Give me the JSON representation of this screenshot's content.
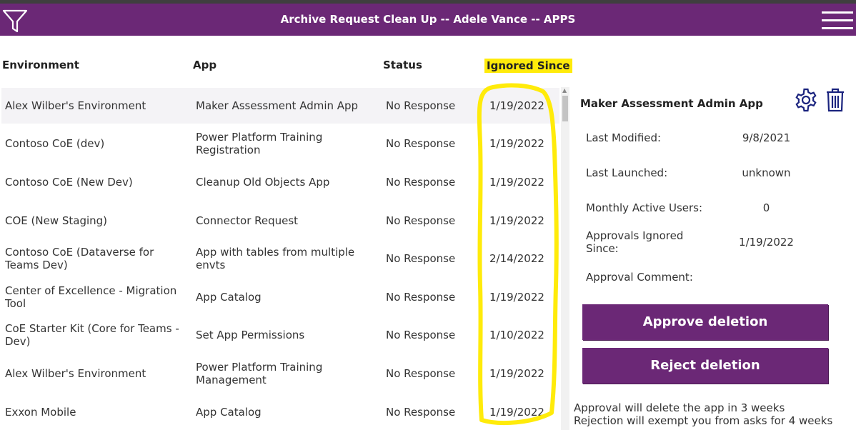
{
  "header": {
    "title": "Archive Request Clean Up -- Adele Vance -- APPS"
  },
  "columns": {
    "environment": "Environment",
    "app": "App",
    "status": "Status",
    "ignored_since": "Ignored Since"
  },
  "rows": [
    {
      "environment": "Alex Wilber's Environment",
      "app": "Maker Assessment Admin App",
      "status": "No Response",
      "ignored_since": "1/19/2022"
    },
    {
      "environment": "Contoso CoE (dev)",
      "app": "Power Platform Training Registration",
      "status": "No Response",
      "ignored_since": "1/19/2022"
    },
    {
      "environment": "Contoso CoE (New Dev)",
      "app": "Cleanup Old Objects App",
      "status": "No Response",
      "ignored_since": "1/19/2022"
    },
    {
      "environment": "COE (New Staging)",
      "app": "Connector Request",
      "status": "No Response",
      "ignored_since": "1/19/2022"
    },
    {
      "environment": "Contoso CoE (Dataverse for Teams Dev)",
      "app": "App with tables from multiple envts",
      "status": "No Response",
      "ignored_since": "2/14/2022"
    },
    {
      "environment": "Center of Excellence - Migration Tool",
      "app": "App Catalog",
      "status": "No Response",
      "ignored_since": "1/19/2022"
    },
    {
      "environment": "CoE Starter Kit (Core for Teams - Dev)",
      "app": "Set App Permissions",
      "status": "No Response",
      "ignored_since": "1/10/2022"
    },
    {
      "environment": "Alex Wilber's Environment",
      "app": "Power Platform Training Management",
      "status": "No Response",
      "ignored_since": "1/19/2022"
    },
    {
      "environment": "Exxon Mobile",
      "app": "App Catalog",
      "status": "No Response",
      "ignored_since": "1/19/2022"
    }
  ],
  "detail": {
    "app_name": "Maker Assessment Admin App",
    "last_modified_label": "Last Modified:",
    "last_modified_value": "9/8/2021",
    "last_launched_label": "Last Launched:",
    "last_launched_value": "unknown",
    "mau_label": "Monthly Active Users:",
    "mau_value": "0",
    "approvals_ignored_label": "Approvals Ignored Since:",
    "approvals_ignored_value": "1/19/2022",
    "approval_comment_label": "Approval Comment:"
  },
  "actions": {
    "approve_label": "Approve deletion",
    "reject_label": "Reject deletion"
  },
  "notes": {
    "approve_note": "Approval will delete the app in 3 weeks",
    "reject_note": "Rejection will exempt you from asks for 4 weeks"
  },
  "icons": {
    "filter": "filter-icon",
    "menu": "hamburger-menu-icon",
    "settings": "gear-icon",
    "delete": "trash-icon"
  },
  "colors": {
    "brand": "#6b2876",
    "highlight": "#ffeb0a",
    "selected_row": "#f4f3f6"
  }
}
